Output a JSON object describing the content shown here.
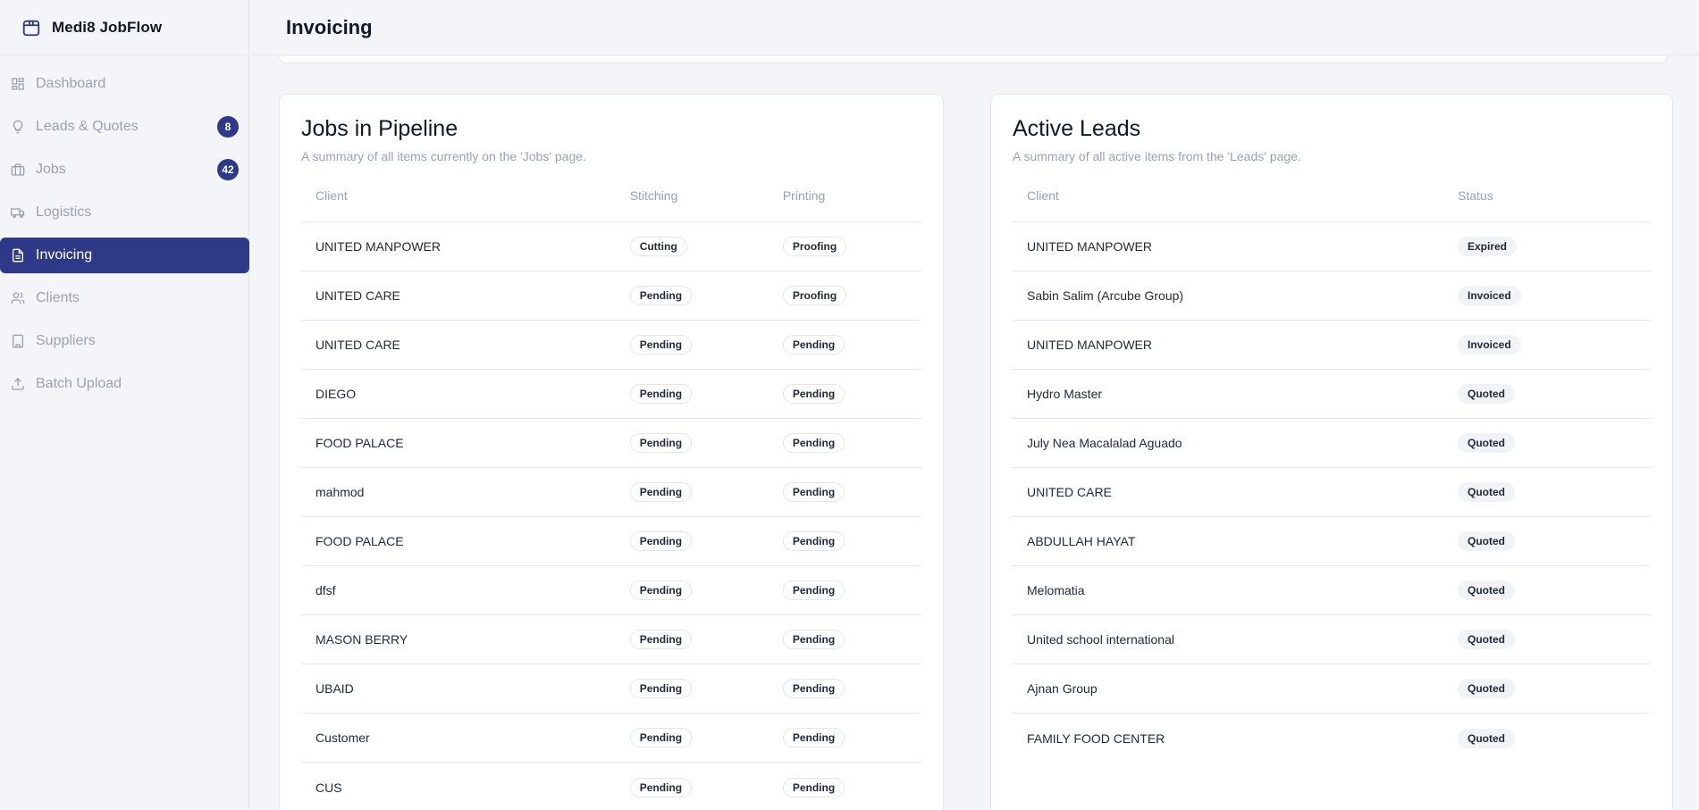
{
  "app": {
    "name": "Medi8 JobFlow",
    "logo_icon": "package-icon"
  },
  "header": {
    "title": "Invoicing"
  },
  "sidebar": {
    "items": [
      {
        "label": "Dashboard",
        "icon": "dashboard-icon",
        "active": false,
        "badge": null
      },
      {
        "label": "Leads & Quotes",
        "icon": "lightbulb-icon",
        "active": false,
        "badge": "8"
      },
      {
        "label": "Jobs",
        "icon": "briefcase-icon",
        "active": false,
        "badge": "42"
      },
      {
        "label": "Logistics",
        "icon": "truck-icon",
        "active": false,
        "badge": null
      },
      {
        "label": "Invoicing",
        "icon": "document-icon",
        "active": true,
        "badge": null
      },
      {
        "label": "Clients",
        "icon": "users-icon",
        "active": false,
        "badge": null
      },
      {
        "label": "Suppliers",
        "icon": "building-icon",
        "active": false,
        "badge": null
      },
      {
        "label": "Batch Upload",
        "icon": "upload-icon",
        "active": false,
        "badge": null
      }
    ]
  },
  "jobs": {
    "title": "Jobs in Pipeline",
    "subtitle": "A summary of all items currently on the 'Jobs' page.",
    "columns": [
      "Client",
      "Stitching",
      "Printing"
    ],
    "rows": [
      {
        "client": "UNITED MANPOWER",
        "stitching": "Cutting",
        "printing": "Proofing"
      },
      {
        "client": "UNITED CARE",
        "stitching": "Pending",
        "printing": "Proofing"
      },
      {
        "client": "UNITED CARE",
        "stitching": "Pending",
        "printing": "Pending"
      },
      {
        "client": "DIEGO",
        "stitching": "Pending",
        "printing": "Pending"
      },
      {
        "client": "FOOD PALACE",
        "stitching": "Pending",
        "printing": "Pending"
      },
      {
        "client": "mahmod",
        "stitching": "Pending",
        "printing": "Pending"
      },
      {
        "client": "FOOD PALACE",
        "stitching": "Pending",
        "printing": "Pending"
      },
      {
        "client": "dfsf",
        "stitching": "Pending",
        "printing": "Pending"
      },
      {
        "client": "MASON BERRY",
        "stitching": "Pending",
        "printing": "Pending"
      },
      {
        "client": "UBAID",
        "stitching": "Pending",
        "printing": "Pending"
      },
      {
        "client": "Customer",
        "stitching": "Pending",
        "printing": "Pending"
      },
      {
        "client": "CUS",
        "stitching": "Pending",
        "printing": "Pending"
      }
    ]
  },
  "leads": {
    "title": "Active Leads",
    "subtitle": "A summary of all active items from the 'Leads' page.",
    "columns": [
      "Client",
      "Status"
    ],
    "rows": [
      {
        "client": "UNITED MANPOWER",
        "status": "Expired"
      },
      {
        "client": "Sabin Salim (Arcube Group)",
        "status": "Invoiced"
      },
      {
        "client": "UNITED MANPOWER",
        "status": "Invoiced"
      },
      {
        "client": "Hydro Master",
        "status": "Quoted"
      },
      {
        "client": "July Nea Macalalad Aguado",
        "status": "Quoted"
      },
      {
        "client": "UNITED CARE",
        "status": "Quoted"
      },
      {
        "client": "ABDULLAH HAYAT",
        "status": "Quoted"
      },
      {
        "client": "Melomatia",
        "status": "Quoted"
      },
      {
        "client": "United school international",
        "status": "Quoted"
      },
      {
        "client": "Ajnan Group",
        "status": "Quoted"
      },
      {
        "client": "FAMILY FOOD CENTER",
        "status": "Quoted"
      }
    ]
  },
  "colors": {
    "accent": "#2e3a87",
    "muted": "#9aa2b1",
    "border": "#e3e6eb",
    "background": "#f3f5f8"
  }
}
